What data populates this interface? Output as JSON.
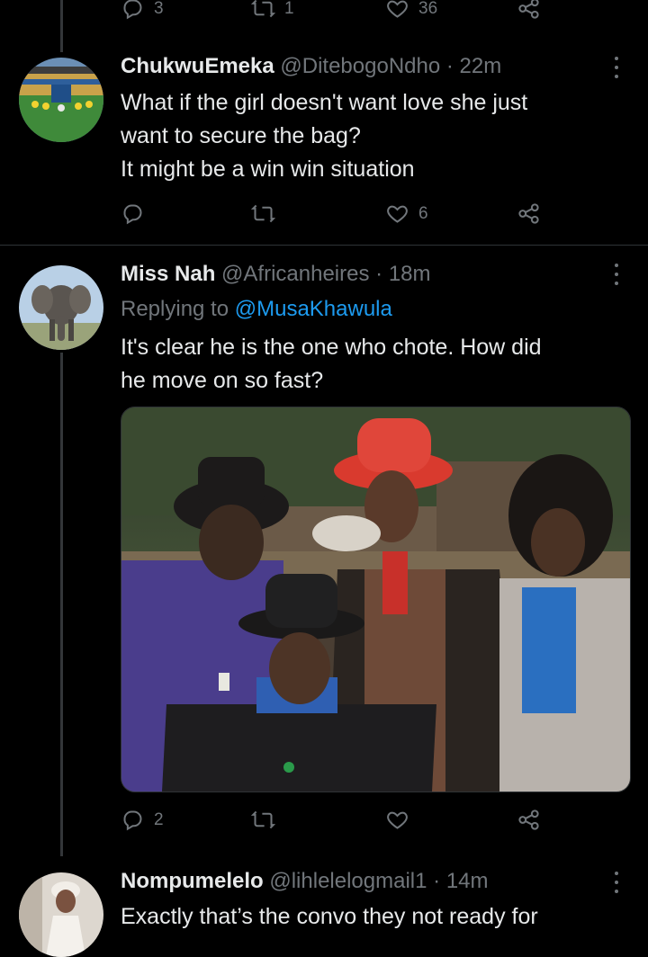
{
  "top_actions": {
    "reply_count": "3",
    "retweet_count": "1",
    "like_count": "36"
  },
  "tweets": [
    {
      "name": "ChukwuEmeka",
      "handle": "@DitebogoNdho",
      "separator": "·",
      "time": "22m",
      "lines": [
        "What if the girl doesn't want love she just",
        "want to secure the bag?",
        "It might be a win win situation"
      ],
      "reply_count": "",
      "retweet_count": "",
      "like_count": "6"
    },
    {
      "name": "Miss Nah",
      "handle": "@Africanheires",
      "separator": "·",
      "time": "18m",
      "replying_prefix": "Replying to",
      "replying_to": "@MusaKhawula",
      "lines": [
        "It's clear he is the one who chote. How did",
        "he move on so fast?"
      ],
      "reply_count": "2",
      "retweet_count": "",
      "like_count": ""
    },
    {
      "name": "Nompumelelo",
      "handle": "@lihlelelogmail1",
      "separator": "·",
      "time": "14m",
      "lines": [
        "Exactly that’s the convo they not ready for"
      ]
    }
  ],
  "icons": {
    "reply": "reply-icon",
    "retweet": "retweet-icon",
    "like": "heart-icon",
    "share": "share-icon",
    "more": "more-icon"
  },
  "colors": {
    "background": "#000000",
    "text": "#e7e9ea",
    "muted": "#71767b",
    "link": "#1d9bf0",
    "divider": "#2f3336"
  }
}
